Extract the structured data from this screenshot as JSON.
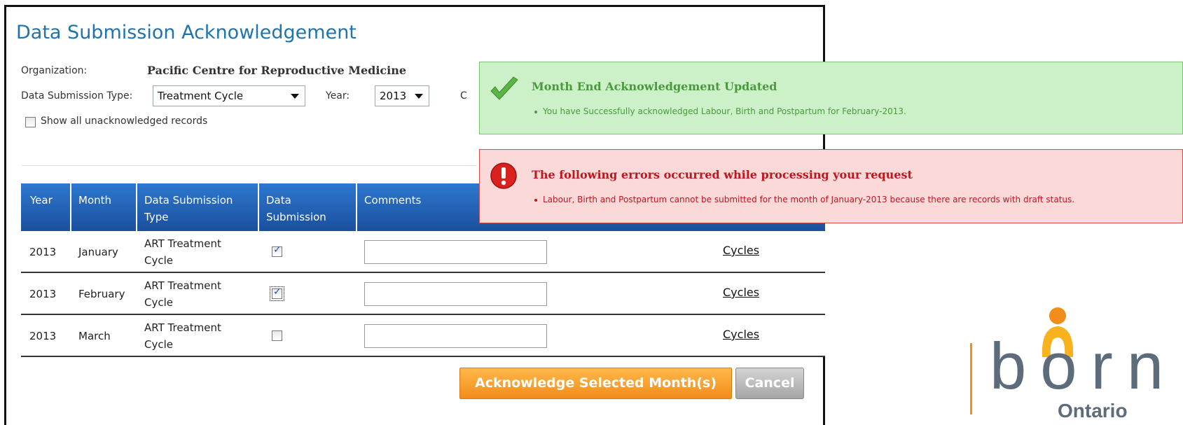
{
  "page": {
    "title": "Data Submission Acknowledgement",
    "organization_label": "Organization:",
    "organization_value": "Pacific Centre for Reproductive Medicine",
    "submission_type_label": "Data Submission Type:",
    "submission_type_value": "Treatment Cycle",
    "year_label": "Year:",
    "year_value": "2013",
    "cut_label": "C",
    "show_unack_label": "Show all unacknowledged records"
  },
  "table": {
    "headers": [
      "Year",
      "Month",
      "Data Submission Type",
      "Data Submission",
      "Comments"
    ],
    "rows": [
      {
        "year": "2013",
        "month": "January",
        "type": "ART Treatment Cycle",
        "checked": true,
        "link": "Cycles"
      },
      {
        "year": "2013",
        "month": "February",
        "type": "ART Treatment Cycle",
        "checked": true,
        "link": "Cycles"
      },
      {
        "year": "2013",
        "month": "March",
        "type": "ART Treatment Cycle",
        "checked": false,
        "link": "Cycles"
      }
    ]
  },
  "buttons": {
    "acknowledge": "Acknowledge Selected Month(s)",
    "cancel": "Cancel"
  },
  "messages": {
    "success_title": "Month End Acknowledgement Updated",
    "success_body": "You have Successfully acknowledged Labour, Birth and Postpartum for February-2013.",
    "error_title": "The following errors occurred while processing your request",
    "error_body": "Labour, Birth and Postpartum cannot be submitted for the month of January-2013 because there are records with draft status."
  },
  "logo": {
    "main": "born",
    "sub": "Ontario"
  },
  "colors": {
    "title_blue": "#1f74ad",
    "header_blue": "#1b4f9e",
    "accent_orange": "#f28c1a",
    "success_green": "#4a9a3d",
    "error_red": "#c0161d"
  }
}
